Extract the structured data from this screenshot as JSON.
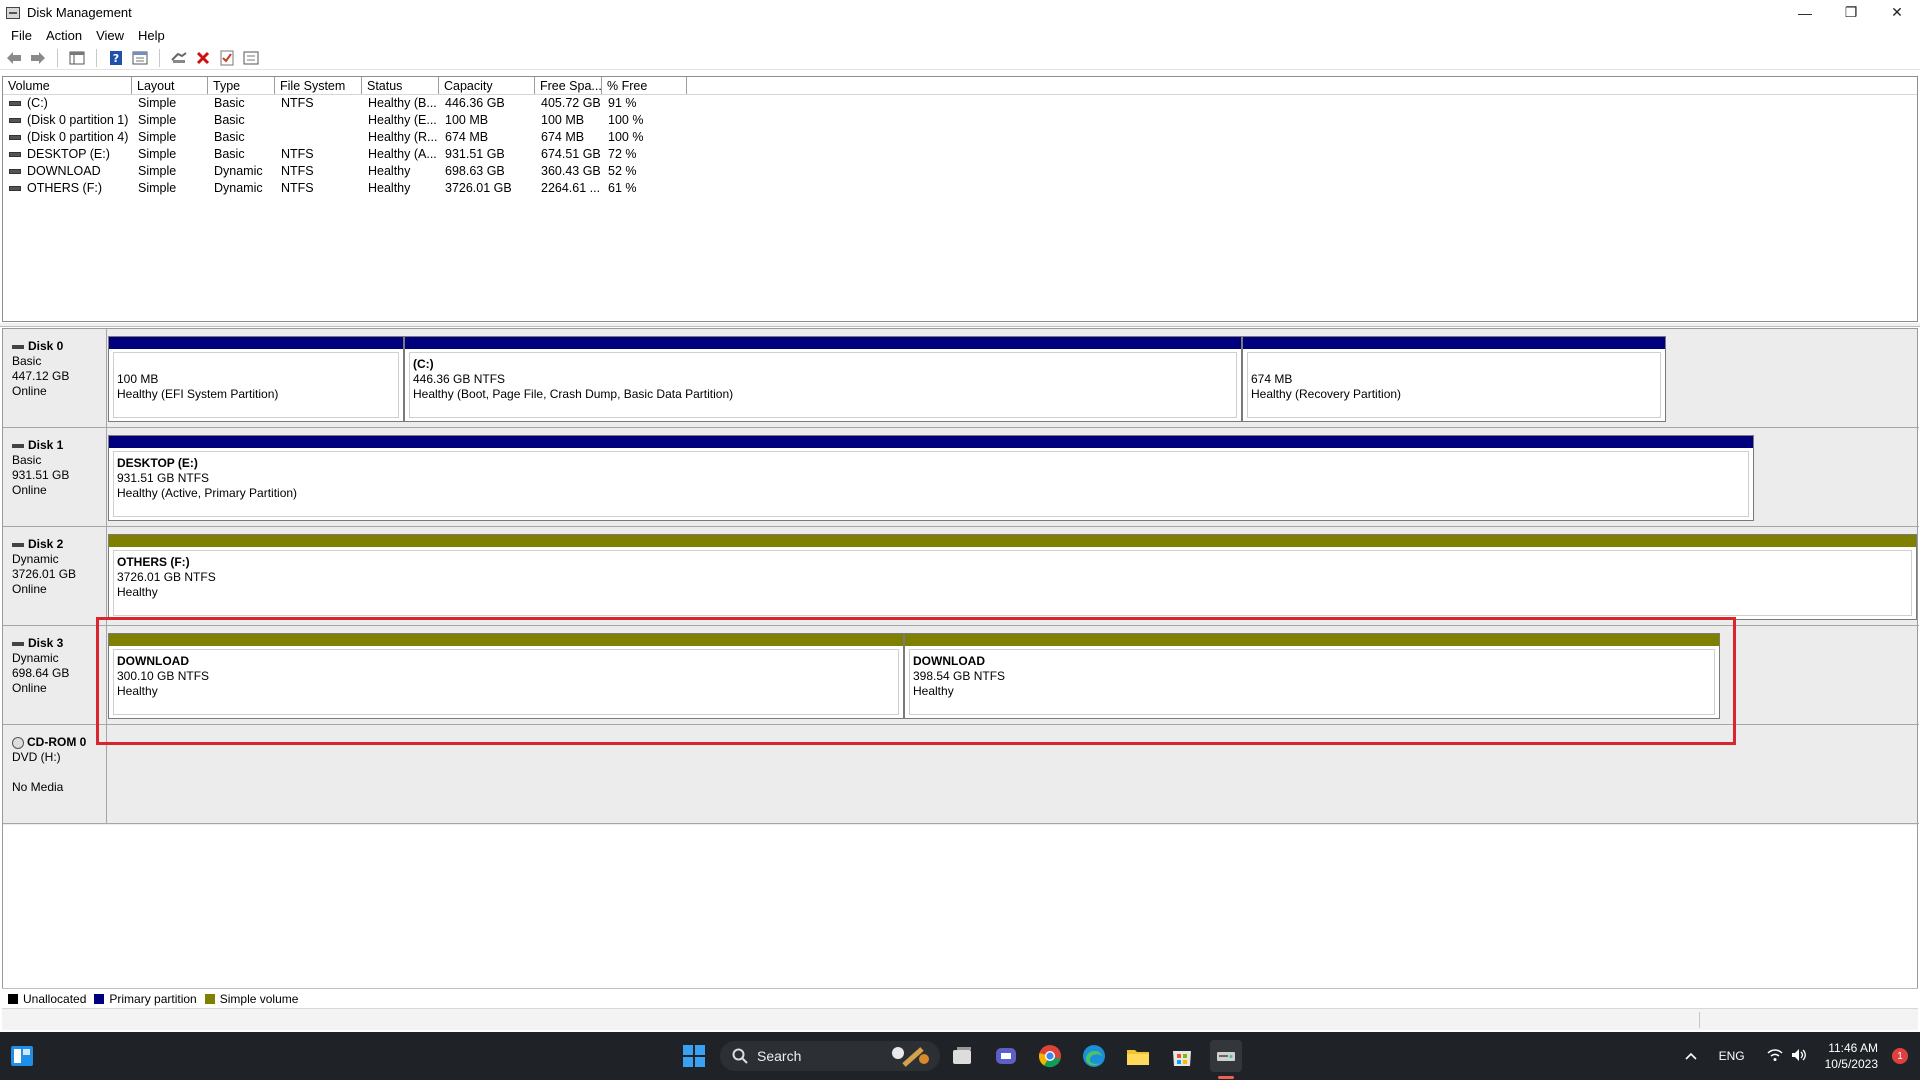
{
  "window": {
    "title": "Disk Management",
    "controls": {
      "minimize": "—",
      "restore": "❐",
      "close": "✕"
    }
  },
  "menu": [
    "File",
    "Action",
    "View",
    "Help"
  ],
  "toolbar": {
    "buttons": [
      "back-arrow-icon",
      "forward-arrow-icon",
      "volume-list-icon",
      "help-icon",
      "properties-icon",
      "connect-icon",
      "delete-icon",
      "check-icon",
      "settings-icon"
    ]
  },
  "volume_list": {
    "columns": [
      "Volume",
      "Layout",
      "Type",
      "File System",
      "Status",
      "Capacity",
      "Free Spa...",
      "% Free"
    ],
    "rows": [
      [
        "(C:)",
        "Simple",
        "Basic",
        "NTFS",
        "Healthy (B...",
        "446.36 GB",
        "405.72 GB",
        "91 %"
      ],
      [
        "(Disk 0 partition 1)",
        "Simple",
        "Basic",
        "",
        "Healthy (E...",
        "100 MB",
        "100 MB",
        "100 %"
      ],
      [
        "(Disk 0 partition 4)",
        "Simple",
        "Basic",
        "",
        "Healthy (R...",
        "674 MB",
        "674 MB",
        "100 %"
      ],
      [
        "DESKTOP (E:)",
        "Simple",
        "Basic",
        "NTFS",
        "Healthy (A...",
        "931.51 GB",
        "674.51 GB",
        "72 %"
      ],
      [
        "DOWNLOAD",
        "Simple",
        "Dynamic",
        "NTFS",
        "Healthy",
        "698.63 GB",
        "360.43 GB",
        "52 %"
      ],
      [
        "OTHERS (F:)",
        "Simple",
        "Dynamic",
        "NTFS",
        "Healthy",
        "3726.01 GB",
        "2264.61 ...",
        "61 %"
      ]
    ]
  },
  "disks": [
    {
      "name": "Disk 0",
      "type": "Basic",
      "size": "447.12 GB",
      "status": "Online",
      "partitions": [
        {
          "name": "",
          "size": "100 MB",
          "health": "Healthy (EFI System Partition)",
          "bar": "primary"
        },
        {
          "name": "(C:)",
          "size": "446.36 GB NTFS",
          "health": "Healthy (Boot, Page File, Crash Dump, Basic Data Partition)",
          "bar": "primary"
        },
        {
          "name": "",
          "size": "674 MB",
          "health": "Healthy (Recovery Partition)",
          "bar": "primary"
        }
      ]
    },
    {
      "name": "Disk 1",
      "type": "Basic",
      "size": "931.51 GB",
      "status": "Online",
      "partitions": [
        {
          "name": "DESKTOP  (E:)",
          "size": "931.51 GB NTFS",
          "health": "Healthy (Active, Primary Partition)",
          "bar": "primary"
        }
      ]
    },
    {
      "name": "Disk 2",
      "type": "Dynamic",
      "size": "3726.01 GB",
      "status": "Online",
      "partitions": [
        {
          "name": "OTHERS  (F:)",
          "size": "3726.01 GB NTFS",
          "health": "Healthy",
          "bar": "simple"
        }
      ]
    },
    {
      "name": "Disk 3",
      "type": "Dynamic",
      "size": "698.64 GB",
      "status": "Online",
      "partitions": [
        {
          "name": "DOWNLOAD",
          "size": "300.10 GB NTFS",
          "health": "Healthy",
          "bar": "simple"
        },
        {
          "name": "DOWNLOAD",
          "size": "398.54 GB NTFS",
          "health": "Healthy",
          "bar": "simple"
        }
      ]
    },
    {
      "name": "CD-ROM 0",
      "type": "DVD (H:)",
      "size": "",
      "status": "No Media",
      "partitions": []
    }
  ],
  "legend": [
    {
      "label": "Unallocated",
      "color": "#000000"
    },
    {
      "label": "Primary partition",
      "color": "#00007f"
    },
    {
      "label": "Simple volume",
      "color": "#808000"
    }
  ],
  "colors": {
    "primary_bar": "#00007f",
    "simple_bar": "#808000",
    "highlight": "#d9262e"
  },
  "taskbar": {
    "search_placeholder": "Search",
    "language": "ENG",
    "time": "11:46 AM",
    "date": "10/5/2023",
    "notification_count": "1"
  }
}
